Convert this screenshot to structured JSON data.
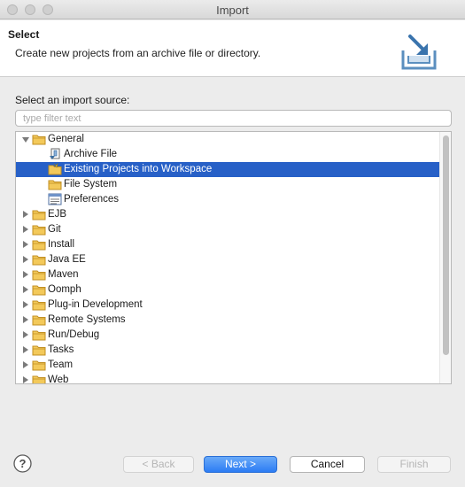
{
  "window": {
    "title": "Import"
  },
  "header": {
    "title": "Select",
    "description": "Create new projects from an archive file or directory.",
    "icon": "import-wizard-icon"
  },
  "source": {
    "label": "Select an import source:",
    "filter_placeholder": "type filter text",
    "filter_value": ""
  },
  "tree": {
    "rows": [
      {
        "label": "General",
        "level": 0,
        "expanded": true,
        "icon": "folder-icon"
      },
      {
        "label": "Archive File",
        "level": 1,
        "icon": "archive-file-icon"
      },
      {
        "label": "Existing Projects into Workspace",
        "level": 1,
        "icon": "project-folder-icon",
        "selected": true
      },
      {
        "label": "File System",
        "level": 1,
        "icon": "folder-icon"
      },
      {
        "label": "Preferences",
        "level": 1,
        "icon": "preferences-icon"
      },
      {
        "label": "EJB",
        "level": 0,
        "expanded": false,
        "icon": "folder-icon"
      },
      {
        "label": "Git",
        "level": 0,
        "expanded": false,
        "icon": "folder-icon"
      },
      {
        "label": "Install",
        "level": 0,
        "expanded": false,
        "icon": "folder-icon"
      },
      {
        "label": "Java EE",
        "level": 0,
        "expanded": false,
        "icon": "folder-icon"
      },
      {
        "label": "Maven",
        "level": 0,
        "expanded": false,
        "icon": "folder-icon"
      },
      {
        "label": "Oomph",
        "level": 0,
        "expanded": false,
        "icon": "folder-icon"
      },
      {
        "label": "Plug-in Development",
        "level": 0,
        "expanded": false,
        "icon": "folder-icon"
      },
      {
        "label": "Remote Systems",
        "level": 0,
        "expanded": false,
        "icon": "folder-icon"
      },
      {
        "label": "Run/Debug",
        "level": 0,
        "expanded": false,
        "icon": "folder-icon"
      },
      {
        "label": "Tasks",
        "level": 0,
        "expanded": false,
        "icon": "folder-icon"
      },
      {
        "label": "Team",
        "level": 0,
        "expanded": false,
        "icon": "folder-icon"
      },
      {
        "label": "Web",
        "level": 0,
        "expanded": false,
        "icon": "folder-icon"
      }
    ]
  },
  "buttons": {
    "back": "< Back",
    "next": "Next >",
    "cancel": "Cancel",
    "finish": "Finish"
  },
  "colors": {
    "selection": "#2760c7",
    "primary_button": "#3d8bf6",
    "folder": "#e9b63c"
  }
}
